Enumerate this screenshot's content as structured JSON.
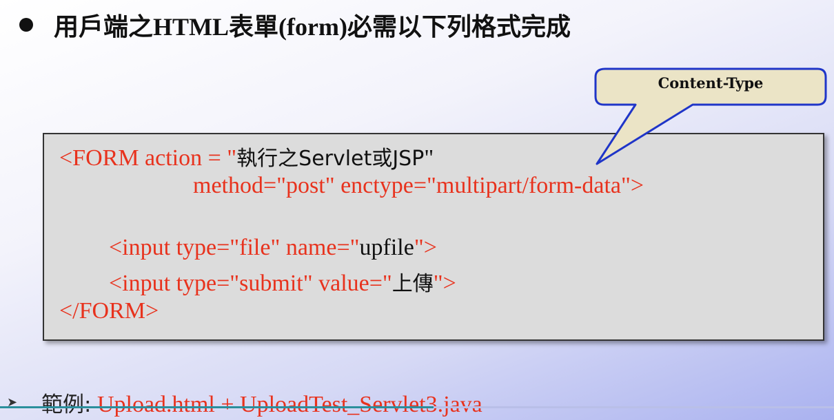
{
  "heading": {
    "text_cjk1": "用戶端之",
    "text_latin": "HTML表單(form)",
    "text_cjk2": "必需以下列格式完成"
  },
  "callout": {
    "label": "Content-Type"
  },
  "code": {
    "line1": {
      "tag": "<FORM action = \"",
      "value": "執行之Servlet或JSP",
      "close": "\""
    },
    "line2": {
      "text": "method=\"post\" enctype=\"multipart/form-data\">"
    },
    "line3": {
      "pre": "<input type=\"file\" name=\"",
      "value": "upfile",
      "post": "\">"
    },
    "line4": {
      "pre": "<input type=\"submit\" value=\"",
      "value": "上傳",
      "post": "\">"
    },
    "line5": {
      "text": "</FORM>"
    }
  },
  "example": {
    "label": "範例:",
    "files": "Upload.html + UploadTest_Servlet3.java"
  },
  "progress": {
    "fraction": 0.52
  },
  "colors": {
    "code_red": "#e8321d",
    "callout_fill": "#ebe4c6",
    "callout_border": "#1f35c8",
    "code_bg": "#dcdcdc"
  }
}
